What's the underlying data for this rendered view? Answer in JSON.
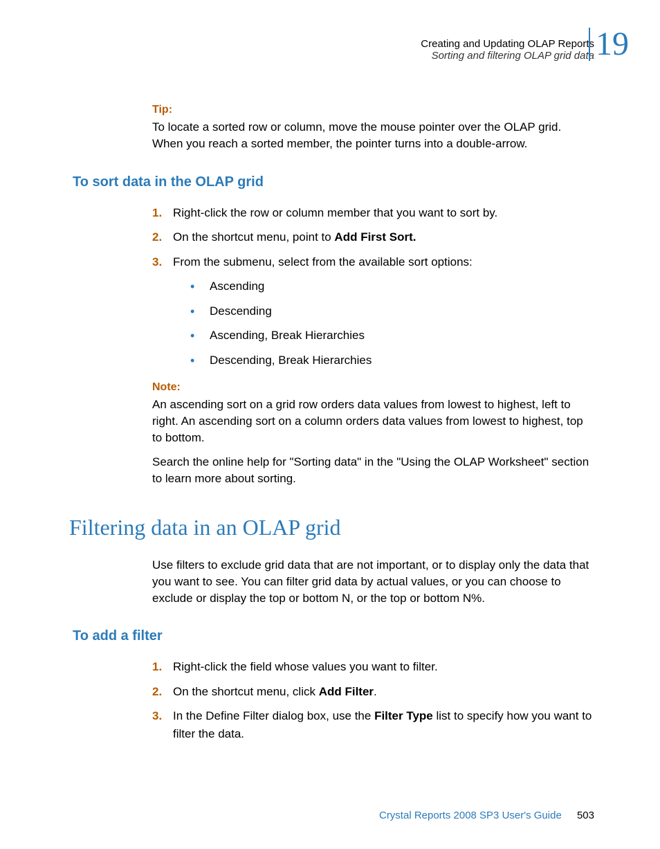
{
  "header": {
    "line1": "Creating and Updating OLAP Reports",
    "line2": "Sorting and filtering OLAP grid data",
    "chapter": "19"
  },
  "tip": {
    "label": "Tip:",
    "text": "To locate a sorted row or column, move the mouse pointer over the OLAP grid. When you reach a sorted member, the pointer turns into a double-arrow."
  },
  "section_sort": {
    "heading": "To sort data in the OLAP grid",
    "steps": [
      {
        "num": "1.",
        "text": "Right-click the row or column member that you want to sort by."
      },
      {
        "num": "2.",
        "prefix": "On the shortcut menu, point to ",
        "bold": "Add First Sort."
      },
      {
        "num": "3.",
        "text": "From the submenu, select from the available sort options:"
      }
    ],
    "bullets": [
      "Ascending",
      "Descending",
      "Ascending, Break Hierarchies",
      "Descending, Break Hierarchies"
    ],
    "note": {
      "label": "Note:",
      "text": "An ascending sort on a grid row orders data values from lowest to highest, left to right. An ascending sort on a column orders data values from lowest to highest, top to bottom."
    },
    "para2": "Search the online help for \"Sorting data\" in the \"Using the OLAP Worksheet\" section to learn more about sorting."
  },
  "section_filter": {
    "heading": "Filtering data in an OLAP grid",
    "intro": "Use filters to exclude grid data that are not important, or to display only the data that you want to see. You can filter grid data by actual values, or you can choose to exclude or display the top or bottom N, or the top or bottom N%.",
    "sub_heading": "To add a filter",
    "steps": [
      {
        "num": "1.",
        "text": "Right-click the field whose values you want to filter."
      },
      {
        "num": "2.",
        "prefix": "On the shortcut menu, click ",
        "bold": "Add Filter",
        "suffix": "."
      },
      {
        "num": "3.",
        "prefix": "In the Define Filter dialog box, use the ",
        "bold": "Filter Type",
        "suffix": " list to specify how you want to filter the data."
      }
    ]
  },
  "footer": {
    "guide": "Crystal Reports 2008 SP3 User's Guide",
    "page": "503"
  }
}
